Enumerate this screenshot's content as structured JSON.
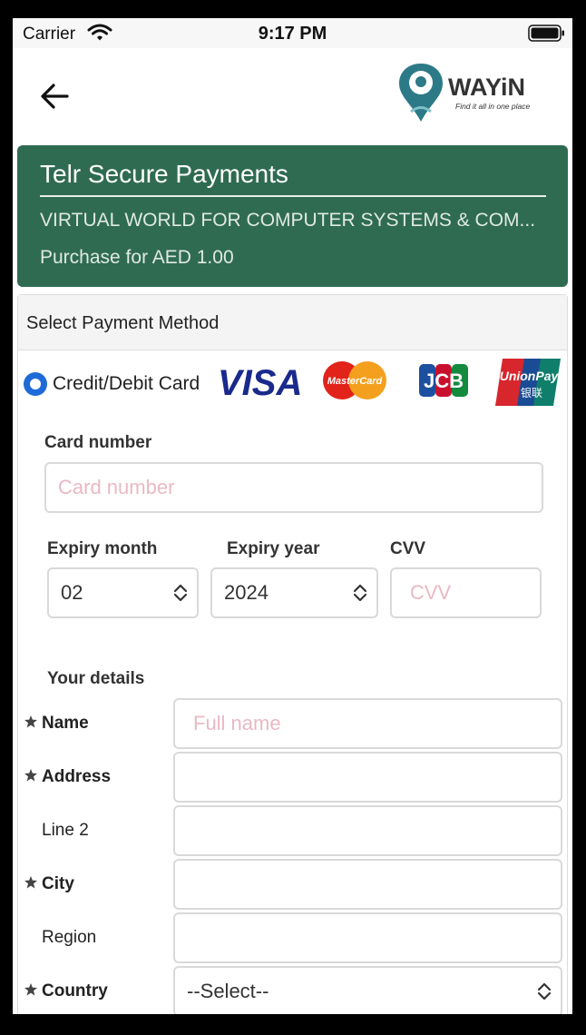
{
  "status_bar": {
    "carrier": "Carrier",
    "time": "9:17 PM"
  },
  "header": {
    "logo": {
      "name": "WAYiN",
      "tagline": "Find it all in one place",
      "brand_color": "#2c7a87"
    }
  },
  "telr": {
    "title": "Telr Secure Payments",
    "merchant": "VIRTUAL WORLD FOR COMPUTER SYSTEMS & COM...",
    "purchase": "Purchase for AED 1.00",
    "color": "#2f6b51"
  },
  "payment": {
    "header": "Select Payment Method",
    "method_label": "Credit/Debit Card",
    "card_logos": [
      "VISA",
      "MasterCard",
      "JCB",
      "UnionPay"
    ],
    "card_number_label": "Card number",
    "card_number_placeholder": "Card number",
    "expiry_month_label": "Expiry month",
    "expiry_month_value": "02",
    "expiry_year_label": "Expiry year",
    "expiry_year_value": "2024",
    "cvv_label": "CVV",
    "cvv_placeholder": "CVV"
  },
  "details": {
    "header": "Your details",
    "name_label": "Name",
    "name_placeholder": "Full name",
    "address_label": "Address",
    "line2_label": "Line 2",
    "city_label": "City",
    "region_label": "Region",
    "country_label": "Country",
    "country_value": "--Select--"
  }
}
